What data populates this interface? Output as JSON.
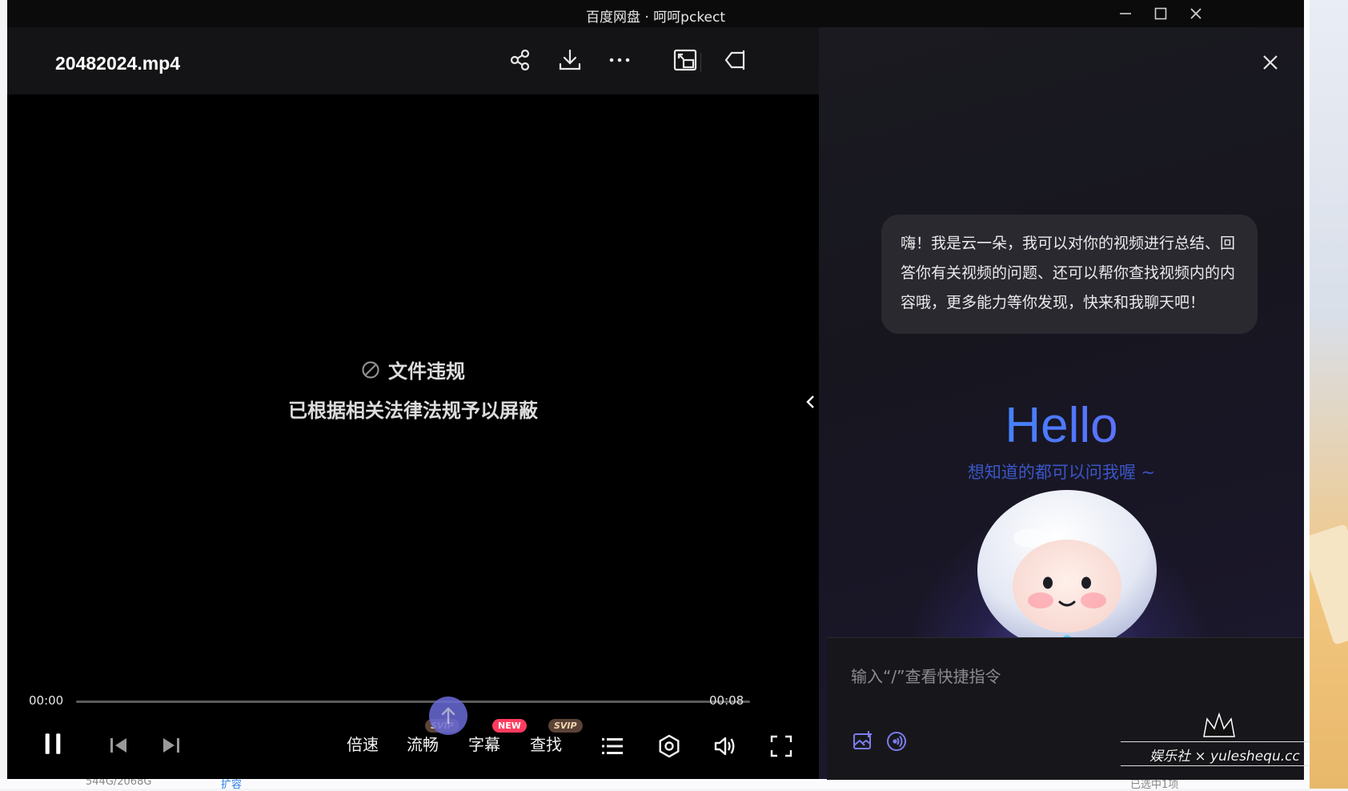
{
  "window": {
    "title": "百度网盘 · 呵呵pckect"
  },
  "player": {
    "file_title": "20482024.mp4",
    "notice_line1": "文件违规",
    "notice_line2": "已根据相关法律法规予以屏蔽",
    "time_current": "00:00",
    "time_total": "00:08",
    "progress_fraction": 0.0,
    "controls": {
      "speed_label": "倍速",
      "quality_label": "流畅",
      "quality_badge": "SVIP",
      "subtitle_label": "字幕",
      "subtitle_badge": "NEW",
      "search_label": "查找",
      "search_badge": "SVIP"
    },
    "header_icons": [
      "share-icon",
      "download-icon",
      "more-icon",
      "picture-in-picture-icon",
      "collapse-panel-icon"
    ]
  },
  "assistant": {
    "greeting": "嗨！我是云一朵，我可以对你的视频进行总结、回答你有关视频的问题、还可以帮你查找视频内的内容哦，更多能力等你发现，快来和我聊天吧！",
    "hello": "Hello",
    "hello_sub": "想知道的都可以问我喔 ~",
    "input_placeholder": "输入“/”查看快捷指令"
  },
  "background_app": {
    "storage": "544G/2068G",
    "expand_link": "扩容",
    "selected": "已选中1项"
  },
  "watermark": {
    "text": "娱乐社 × yuleshequ.cc"
  },
  "colors": {
    "accent_blue": "#2aa5ff",
    "accent_purple": "#8a5cff",
    "badge_new": "#ff3b5f",
    "badge_svip": "#5b4337"
  }
}
